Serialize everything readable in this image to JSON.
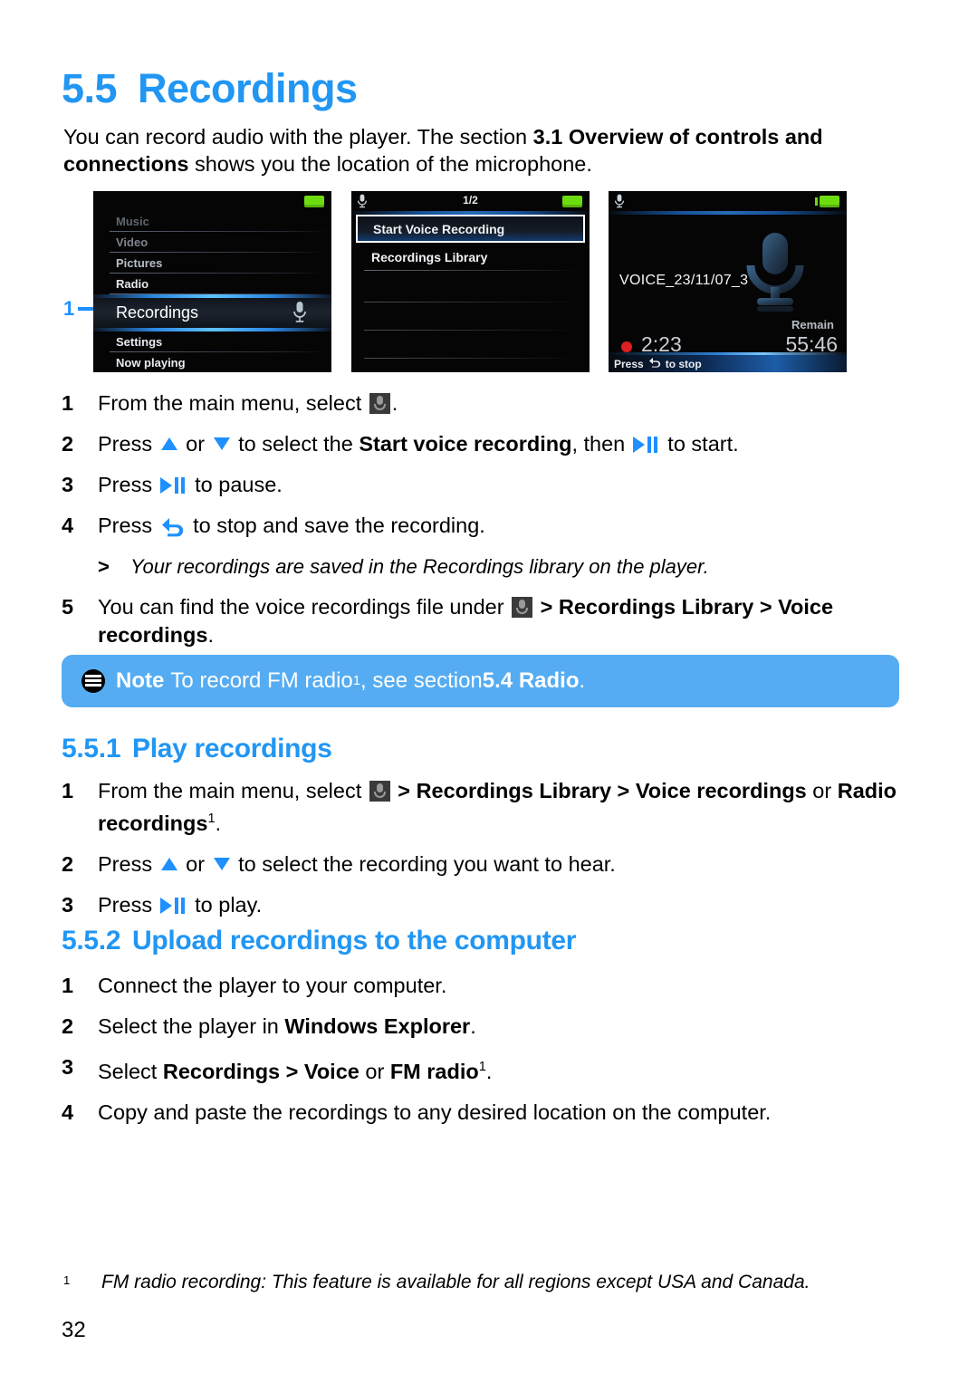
{
  "document": {
    "page_number": "32",
    "heading": {
      "number": "5.5",
      "title": "Recordings"
    },
    "intro": {
      "part1": "You can record audio with the player. The section ",
      "bold1": "3.1 Overview of controls and connections",
      "part2": " shows you the location of the microphone."
    }
  },
  "callout": {
    "label": "1"
  },
  "screens": [
    {
      "name": "main-menu",
      "status": {
        "title": "",
        "battery": "full"
      },
      "items": [
        {
          "label": "Music",
          "state": "dim1"
        },
        {
          "label": "Video",
          "state": "dim2"
        },
        {
          "label": "Pictures",
          "state": "dim3"
        },
        {
          "label": "Radio",
          "state": "dim4"
        },
        {
          "label": "Recordings",
          "state": "selected",
          "icon": "microphone-icon"
        },
        {
          "label": "Settings",
          "state": "dim5"
        },
        {
          "label": "Now playing",
          "state": "dim6"
        }
      ]
    },
    {
      "name": "recordings-menu",
      "status": {
        "title": "1/2",
        "battery": "full",
        "icon": "microphone-icon"
      },
      "items": [
        {
          "label": "Start Voice Recording",
          "state": "selected"
        },
        {
          "label": "Recordings Library",
          "state": "normal"
        }
      ]
    },
    {
      "name": "voice-recording",
      "status": {
        "title": "",
        "battery": "full",
        "icon": "microphone-icon"
      },
      "file_name": "VOICE_23/11/07_3",
      "remain_label": "Remain",
      "elapsed_time": "2:23",
      "remaining_time": "55:46",
      "footer_prefix": "Press",
      "footer_suffix": "to stop"
    }
  ],
  "steps_main": [
    {
      "index": "1",
      "segments": [
        {
          "t": "text",
          "v": "From the main menu, select "
        },
        {
          "t": "icon",
          "v": "mic"
        },
        {
          "t": "text",
          "v": "."
        }
      ]
    },
    {
      "index": "2",
      "segments": [
        {
          "t": "text",
          "v": "Press "
        },
        {
          "t": "icon",
          "v": "up"
        },
        {
          "t": "text",
          "v": " or "
        },
        {
          "t": "icon",
          "v": "down"
        },
        {
          "t": "text",
          "v": " to select the "
        },
        {
          "t": "bold",
          "v": "Start voice recording"
        },
        {
          "t": "text",
          "v": ", then "
        },
        {
          "t": "icon",
          "v": "playpause"
        },
        {
          "t": "text",
          "v": " to start."
        }
      ]
    },
    {
      "index": "3",
      "segments": [
        {
          "t": "text",
          "v": "Press "
        },
        {
          "t": "icon",
          "v": "playpause"
        },
        {
          "t": "text",
          "v": " to pause."
        }
      ]
    },
    {
      "index": "4",
      "segments": [
        {
          "t": "text",
          "v": "Press "
        },
        {
          "t": "icon",
          "v": "back"
        },
        {
          "t": "text",
          "v": " to stop and save the recording."
        }
      ]
    }
  ],
  "subnote_main": {
    "marker": ">",
    "text": "Your recordings are saved in the Recordings library on the player."
  },
  "step5": {
    "index": "5",
    "segments": [
      {
        "t": "text",
        "v": "You can find the voice recordings file under "
      },
      {
        "t": "icon",
        "v": "mic"
      },
      {
        "t": "bold",
        "v": " > Recordings Library > Voice recordings"
      },
      {
        "t": "text",
        "v": "."
      }
    ]
  },
  "note": {
    "icon": "note-icon",
    "label": "Note",
    "text_before": " To record FM radio",
    "superscript": "1",
    "text_middle": ", see section ",
    "bold": "5.4 Radio",
    "text_after": "."
  },
  "section_551": {
    "number": "5.5.1",
    "title": "Play recordings",
    "steps": [
      {
        "index": "1",
        "segments": [
          {
            "t": "text",
            "v": "From the main menu, select "
          },
          {
            "t": "icon",
            "v": "mic"
          },
          {
            "t": "bold",
            "v": " > Recordings Library > Voice recordings"
          },
          {
            "t": "text",
            "v": " or "
          },
          {
            "t": "bold",
            "v": "Radio recordings"
          },
          {
            "t": "sup",
            "v": "1"
          },
          {
            "t": "text",
            "v": "."
          }
        ]
      },
      {
        "index": "2",
        "segments": [
          {
            "t": "text",
            "v": "Press "
          },
          {
            "t": "icon",
            "v": "up"
          },
          {
            "t": "text",
            "v": " or "
          },
          {
            "t": "icon",
            "v": "down"
          },
          {
            "t": "text",
            "v": " to select the recording you want to hear."
          }
        ]
      },
      {
        "index": "3",
        "segments": [
          {
            "t": "text",
            "v": "Press "
          },
          {
            "t": "icon",
            "v": "playpause"
          },
          {
            "t": "text",
            "v": " to play."
          }
        ]
      }
    ]
  },
  "section_552": {
    "number": "5.5.2",
    "title": "Upload recordings to the computer",
    "steps": [
      {
        "index": "1",
        "segments": [
          {
            "t": "text",
            "v": "Connect the player to your computer."
          }
        ]
      },
      {
        "index": "2",
        "segments": [
          {
            "t": "text",
            "v": "Select the player in "
          },
          {
            "t": "bold",
            "v": "Windows Explorer"
          },
          {
            "t": "text",
            "v": "."
          }
        ]
      },
      {
        "index": "3",
        "segments": [
          {
            "t": "text",
            "v": "Select "
          },
          {
            "t": "bold",
            "v": "Recordings > Voice"
          },
          {
            "t": "text",
            "v": " or "
          },
          {
            "t": "bold",
            "v": "FM radio"
          },
          {
            "t": "sup",
            "v": "1"
          },
          {
            "t": "text",
            "v": "."
          }
        ]
      },
      {
        "index": "4",
        "segments": [
          {
            "t": "text",
            "v": "Copy and paste the recordings to any desired location on the computer."
          }
        ]
      }
    ]
  },
  "footnote": {
    "marker": "1",
    "text": "FM radio recording: This feature is available for all regions except USA and Canada."
  },
  "colors": {
    "accent_blue": "#2196f3",
    "icon_blue": "#1e90ff",
    "note_bar": "#55ACF2",
    "battery_green": "#6ddc0f",
    "record_red": "#e02020"
  }
}
